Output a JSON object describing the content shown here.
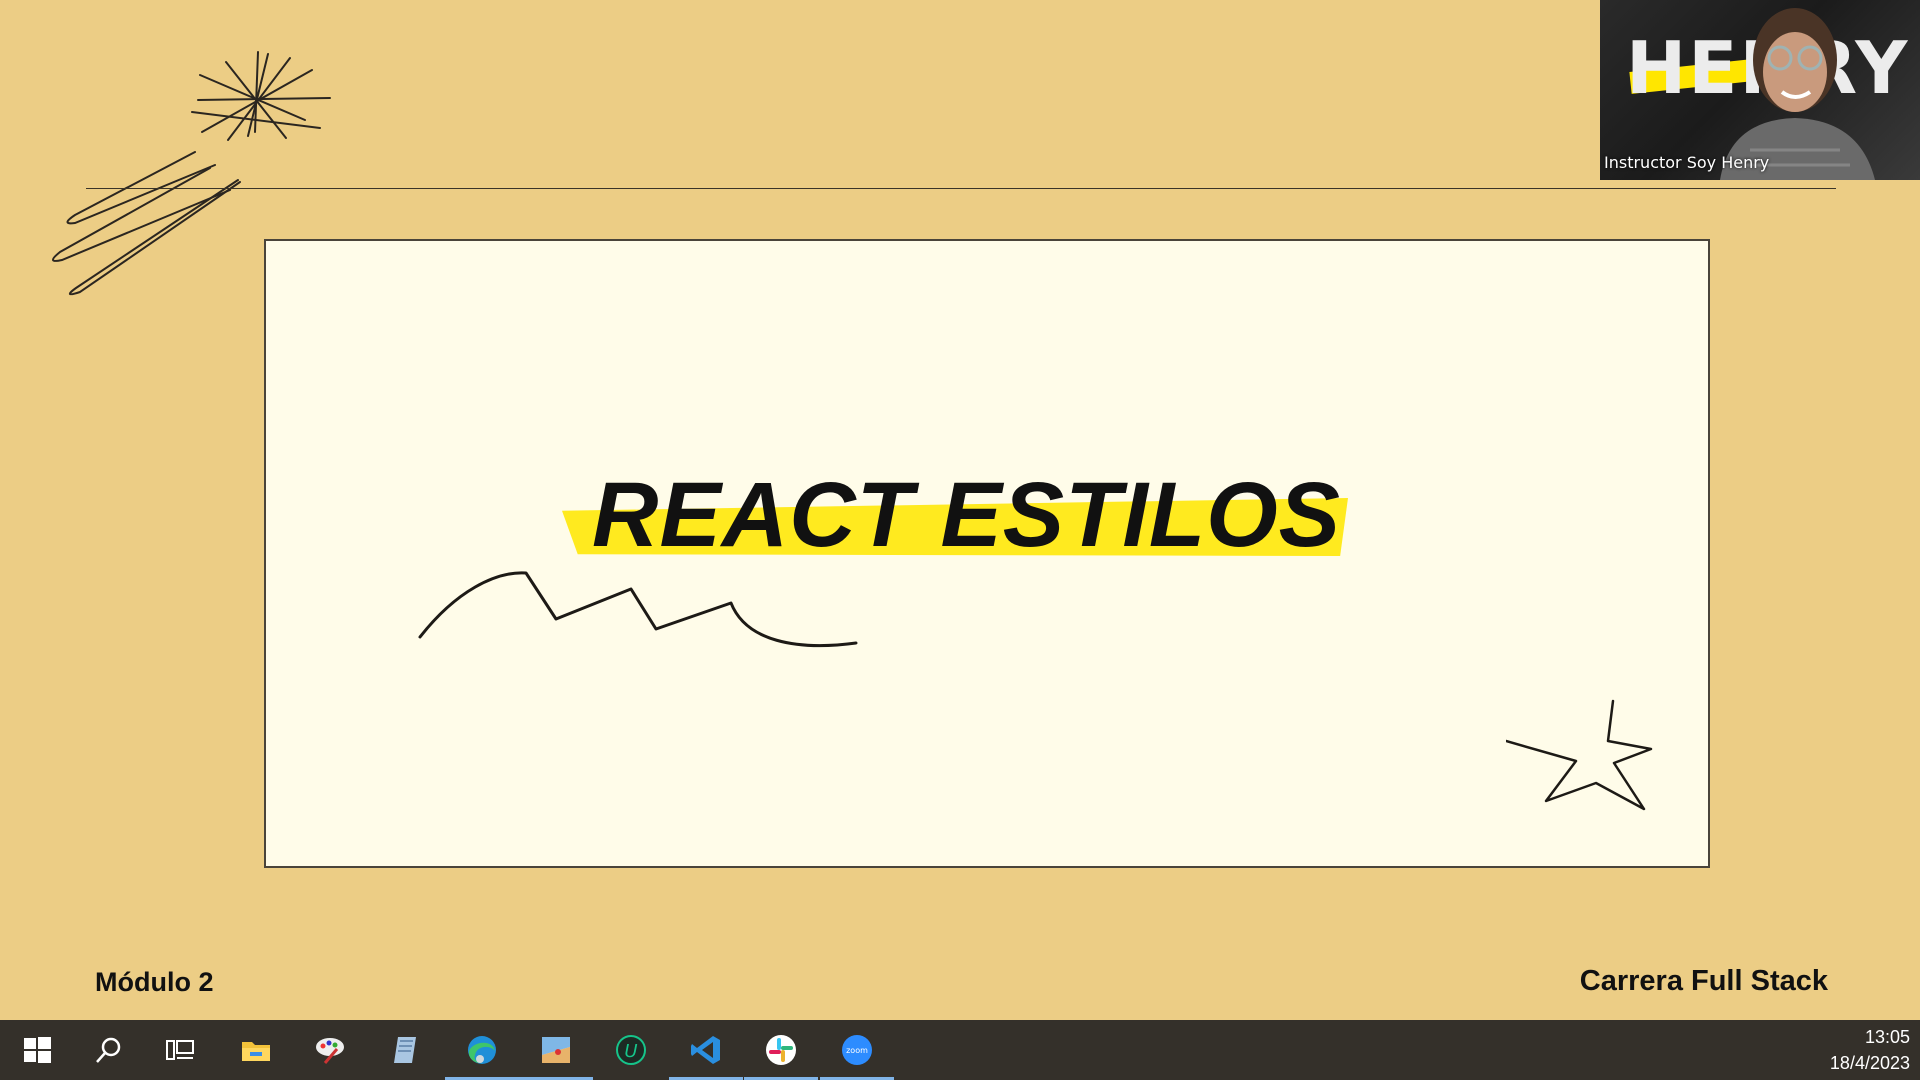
{
  "slide": {
    "title": "REACT ESTILOS",
    "footer_left": "Módulo 2",
    "footer_right": "Carrera Full Stack",
    "colors": {
      "background": "#eccd85",
      "card": "#fffce9",
      "highlight": "#ffea1f"
    }
  },
  "video": {
    "participant_name": "Instructor Soy Henry",
    "brand_text": "HENRY"
  },
  "taskbar": {
    "apps": [
      {
        "name": "start-icon",
        "active": false
      },
      {
        "name": "search-icon",
        "active": false
      },
      {
        "name": "task-view-icon",
        "active": false
      },
      {
        "name": "file-explorer-icon",
        "active": false
      },
      {
        "name": "paint-icon",
        "active": false
      },
      {
        "name": "notepad-icon",
        "active": false
      },
      {
        "name": "edge-icon",
        "active": true
      },
      {
        "name": "image-viewer-icon",
        "active": true
      },
      {
        "name": "upwork-icon",
        "active": false
      },
      {
        "name": "vscode-icon",
        "active": true
      },
      {
        "name": "slack-icon",
        "active": true
      },
      {
        "name": "zoom-icon",
        "active": true
      }
    ],
    "zoom_label": "zoom",
    "upwork_label": "U",
    "time": "13:05",
    "date": "18/4/2023"
  }
}
